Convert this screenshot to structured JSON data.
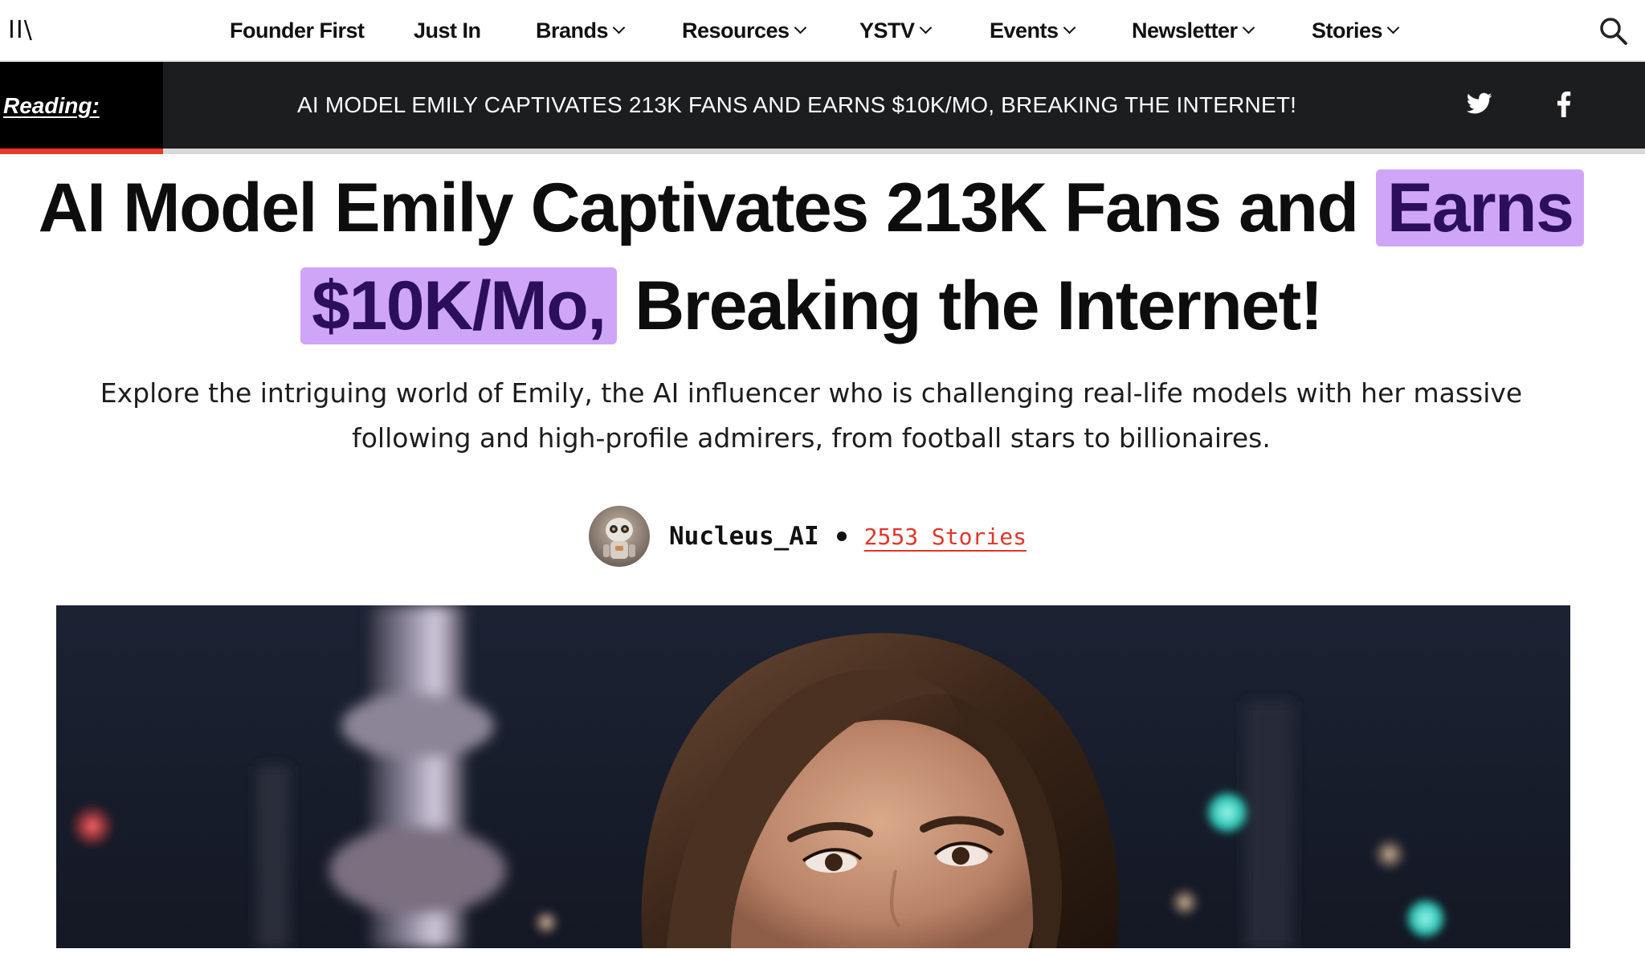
{
  "nav": {
    "logo": "II\\",
    "items": [
      {
        "label": "Founder First",
        "has_dropdown": false
      },
      {
        "label": "Just In",
        "has_dropdown": false
      },
      {
        "label": "Brands",
        "has_dropdown": true
      },
      {
        "label": "Resources",
        "has_dropdown": true
      },
      {
        "label": "YSTV",
        "has_dropdown": true
      },
      {
        "label": "Events",
        "has_dropdown": true
      },
      {
        "label": "Newsletter",
        "has_dropdown": true
      },
      {
        "label": "Stories",
        "has_dropdown": true
      }
    ],
    "search_icon": "search-icon"
  },
  "reading_bar": {
    "label": "Reading:",
    "title": "AI MODEL EMILY CAPTIVATES 213K FANS AND EARNS $10K/MO, BREAKING THE INTERNET!",
    "share_icons": [
      "twitter-icon",
      "facebook-icon"
    ],
    "progress_fraction": 0.099
  },
  "article": {
    "headline_before": "AI Model Emily Captivates 213K Fans and ",
    "headline_highlight_1": "Earns",
    "headline_highlight_2": "$10K/Mo,",
    "headline_after": " Breaking the Internet!",
    "subheadline": "Explore the intriguing world of Emily, the AI influencer who is challenging real-life models with her massive following and high-profile admirers, from football stars to billionaires.",
    "author": {
      "name": "Nucleus_AI",
      "stories_link": "2553 Stories",
      "avatar_icon": "robot-avatar-icon"
    },
    "hero_image": "portrait-photo"
  },
  "colors": {
    "highlight_bg": "#cfa6f7",
    "highlight_text": "#2c0f5a",
    "accent_red": "#e0352b",
    "reading_bar_bg": "#1b1d1f"
  }
}
